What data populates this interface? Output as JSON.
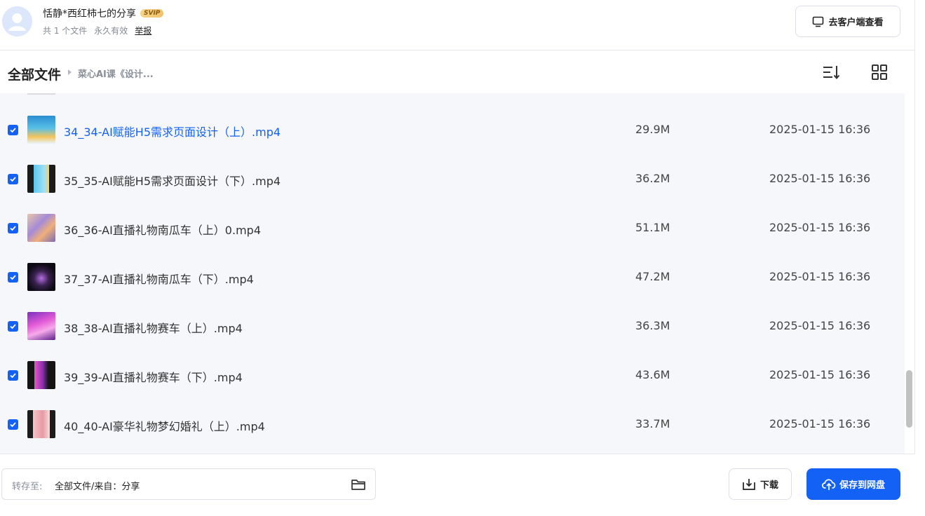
{
  "share": {
    "title": "恬静*西红柿七的分享",
    "badge": "SVIP",
    "count": "共 1 个文件",
    "validity": "永久有效",
    "report": "举报",
    "client_button": "去客户端查看"
  },
  "breadcrumb": {
    "root": "全部文件",
    "current": "菜心AI课《设计..."
  },
  "files": [
    {
      "name": "34_34-AI赋能H5需求页面设计（上）.mp4",
      "size": "29.9M",
      "date": "2025-01-15 16:36",
      "checked": true,
      "active": true
    },
    {
      "name": "35_35-AI赋能H5需求页面设计（下）.mp4",
      "size": "36.2M",
      "date": "2025-01-15 16:36",
      "checked": true
    },
    {
      "name": "36_36-AI直播礼物南瓜车（上）0.mp4",
      "size": "51.1M",
      "date": "2025-01-15 16:36",
      "checked": true
    },
    {
      "name": "37_37-AI直播礼物南瓜车（下）.mp4",
      "size": "47.2M",
      "date": "2025-01-15 16:36",
      "checked": true
    },
    {
      "name": "38_38-AI直播礼物赛车（上）.mp4",
      "size": "36.3M",
      "date": "2025-01-15 16:36",
      "checked": true
    },
    {
      "name": "39_39-AI直播礼物赛车（下）.mp4",
      "size": "43.6M",
      "date": "2025-01-15 16:36",
      "checked": true
    },
    {
      "name": "40_40-AI豪华礼物梦幻婚礼（上）.mp4",
      "size": "33.7M",
      "date": "2025-01-15 16:36",
      "checked": true
    }
  ],
  "footer": {
    "save_to_label": "转存至:",
    "save_to_path": "全部文件/来自：分享",
    "download_label": "下载",
    "save_label": "保存到网盘"
  },
  "colors": {
    "accent": "#1461f5",
    "list_bg": "#f6f7fb"
  }
}
